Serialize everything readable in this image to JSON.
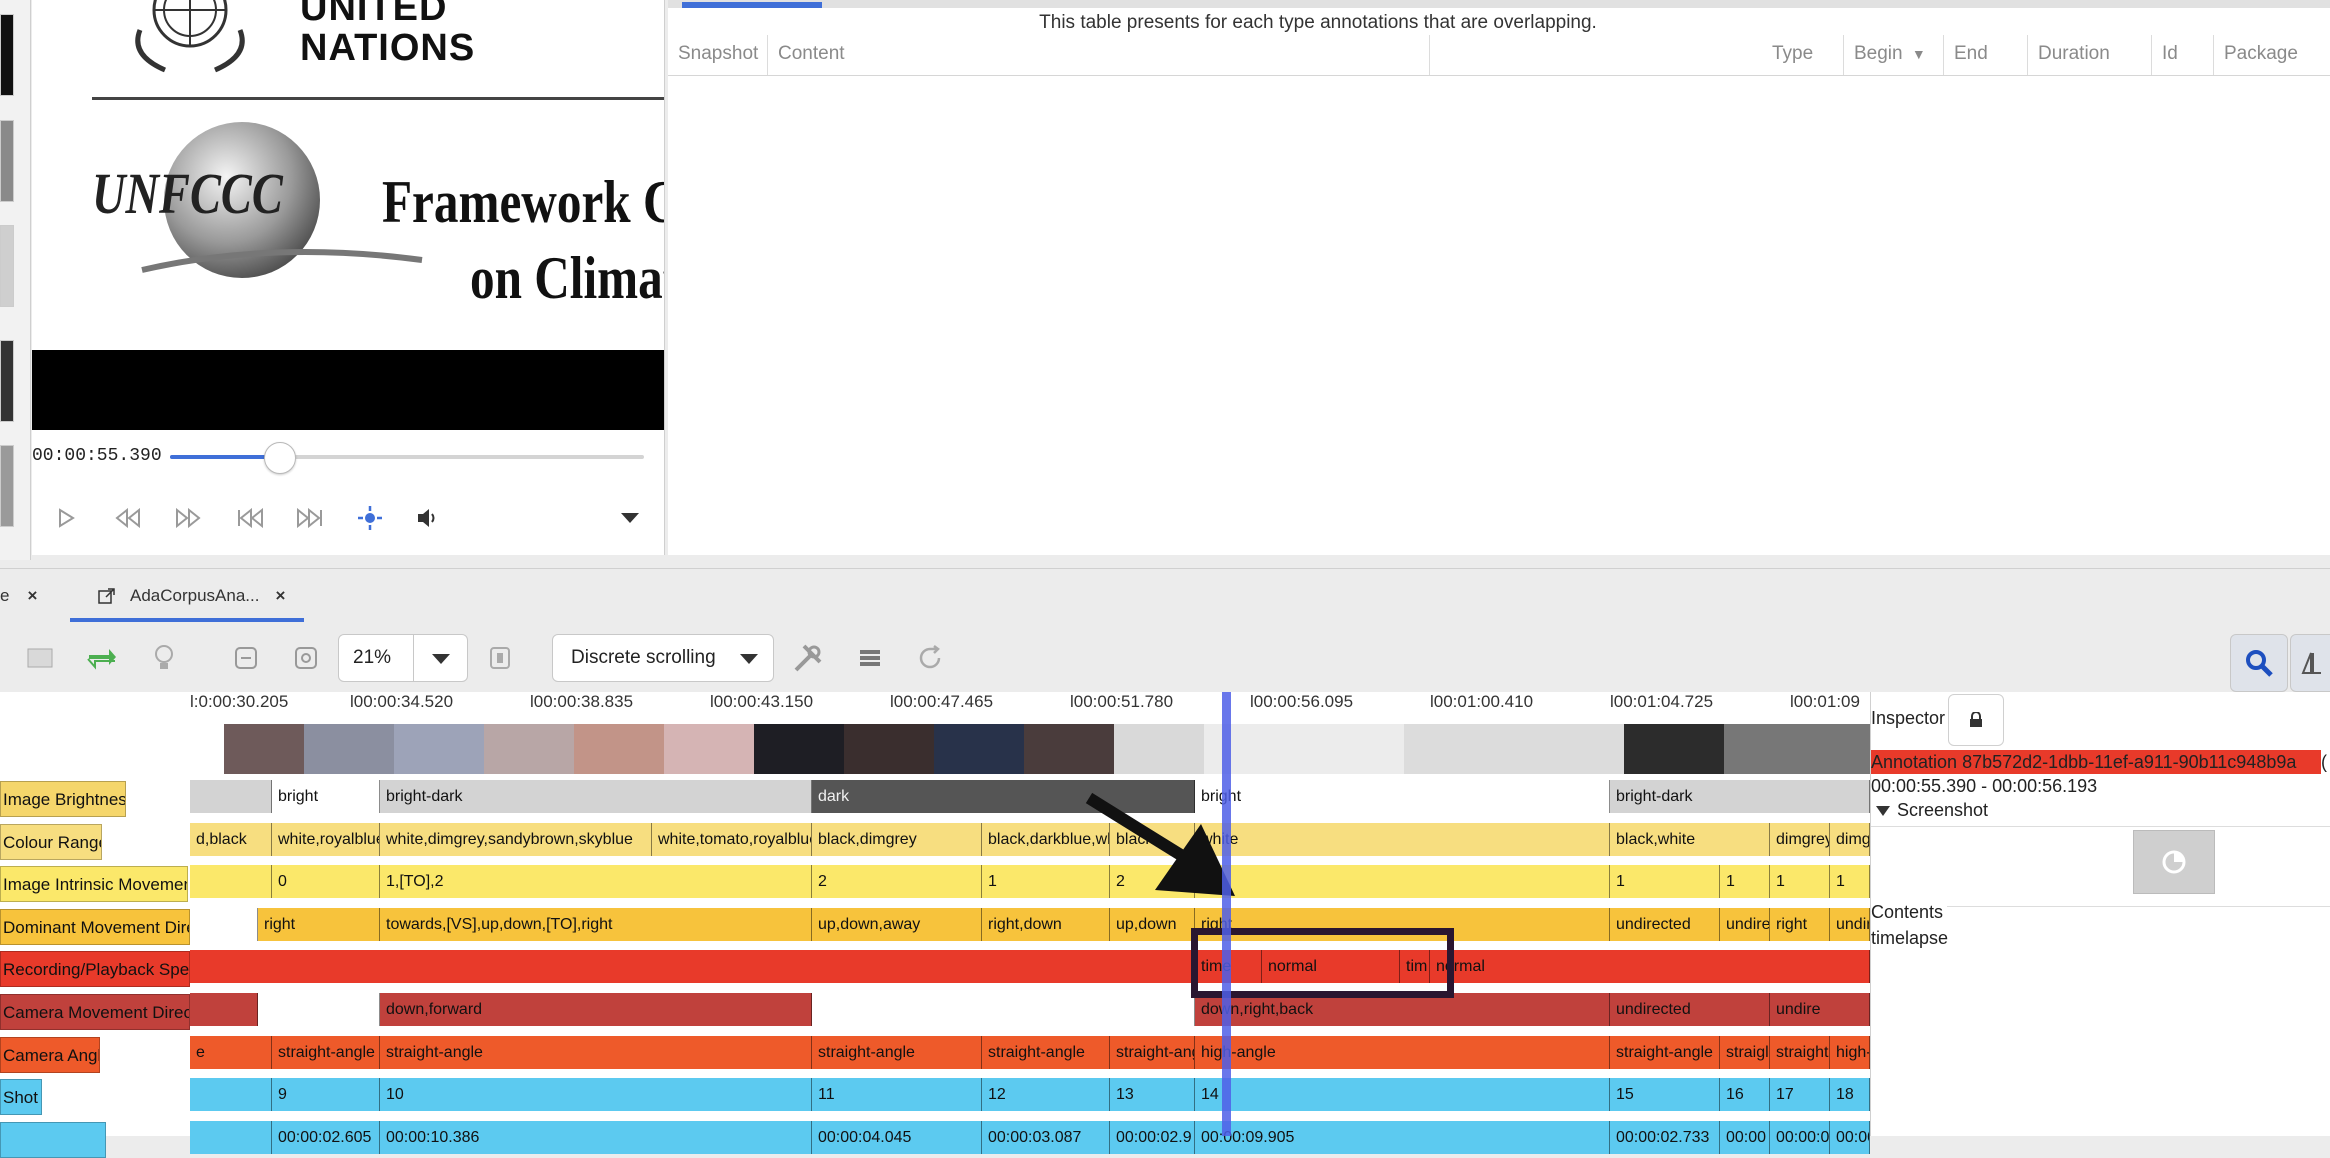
{
  "player": {
    "video_text": {
      "un_line1": "UNITED",
      "un_line2": "NATIONS",
      "unfccc": "UNFCCC",
      "framework_line1": "Framework Con",
      "framework_line2": "on Climate"
    },
    "timecode": "00:00:55.390",
    "progress_fraction": 0.23,
    "icons": [
      "play-icon",
      "step-back-icon",
      "step-forward-icon",
      "skip-start-icon",
      "skip-end-icon",
      "fullscreen-icon",
      "volume-icon",
      "chevron-down-icon"
    ]
  },
  "table_pane": {
    "caption": "This table presents for each type annotations that are overlapping.",
    "columns": [
      "Snapshot",
      "Content",
      "Type",
      "Begin",
      "End",
      "Duration",
      "Id",
      "Package"
    ],
    "sort_indicator": "▼"
  },
  "tabs": [
    {
      "label": "e",
      "close": "×"
    },
    {
      "label": "AdaCorpusAna...",
      "close": "×"
    }
  ],
  "toolbar": {
    "zoom_value": "21%",
    "scroll_mode": "Discrete scrolling"
  },
  "timeline": {
    "ticks": [
      "l:0:00:30.205",
      "l00:00:34.520",
      "l00:00:38.835",
      "l00:00:43.150",
      "l00:00:47.465",
      "l00:00:51.780",
      "l00:00:56.095",
      "l00:01:00.410",
      "l00:01:04.725",
      "l00:01:09"
    ],
    "tracks": [
      {
        "label": "Image Brightness",
        "label_color": "#f5d66b",
        "seg_color": "#ffffff",
        "segments": [
          {
            "text": "",
            "color": "#d3d3d3"
          },
          {
            "text": "bright"
          },
          {
            "text": "bright-dark",
            "color": "#d3d3d3"
          },
          {
            "text": "dark",
            "color": "#555555"
          },
          {
            "text": "bright"
          },
          {
            "text": "bright-dark",
            "color": "#d3d3d3"
          }
        ]
      },
      {
        "label": "Colour Range",
        "label_color": "#f7de80",
        "seg_color": "#f7de80",
        "segments": [
          {
            "text": "d,black"
          },
          {
            "text": "white,royalblue"
          },
          {
            "text": "white,dimgrey,sandybrown,skyblue"
          },
          {
            "text": "white,tomato,royalblue"
          },
          {
            "text": "black,dimgrey"
          },
          {
            "text": "black,darkblue,wh"
          },
          {
            "text": "black"
          },
          {
            "text": "white"
          },
          {
            "text": "black,white"
          },
          {
            "text": "dimgrey"
          },
          {
            "text": "dimg"
          }
        ]
      },
      {
        "label": "Image Intrinsic Movement",
        "label_color": "#fbe86a",
        "seg_color": "#fbe86a",
        "segments": [
          {
            "text": ""
          },
          {
            "text": "0"
          },
          {
            "text": "1,[TO],2"
          },
          {
            "text": "2"
          },
          {
            "text": "1"
          },
          {
            "text": "2"
          },
          {
            "text": "2"
          },
          {
            "text": "1"
          },
          {
            "text": "1"
          },
          {
            "text": "1"
          },
          {
            "text": "1"
          }
        ]
      },
      {
        "label": "Dominant Movement Direc",
        "label_color": "#f7c33c",
        "seg_color": "#f7c33c",
        "segments": [
          {
            "text": "",
            "color": "#ffffff"
          },
          {
            "text": "right"
          },
          {
            "text": "towards,[VS],up,down,[TO],right"
          },
          {
            "text": "up,down,away"
          },
          {
            "text": "right,down"
          },
          {
            "text": "up,down"
          },
          {
            "text": "right"
          },
          {
            "text": "undirected"
          },
          {
            "text": "undire"
          },
          {
            "text": "right"
          },
          {
            "text": "undir"
          }
        ]
      },
      {
        "label": "Recording/Playback Speed",
        "label_color": "#e83a2a",
        "seg_color": "#e83a2a",
        "segments": [
          {
            "text": ""
          },
          {
            "text": "time"
          },
          {
            "text": "normal"
          },
          {
            "text": "tim"
          },
          {
            "text": "normal"
          }
        ]
      },
      {
        "label": "Camera Movement Directio",
        "label_color": "#c0413c",
        "seg_color": "#c0413c",
        "segments": [
          {
            "text": ""
          },
          {
            "text": "",
            "color": "#ffffff"
          },
          {
            "text": "down,forward"
          },
          {
            "text": "",
            "color": "#ffffff"
          },
          {
            "text": "down,right,back"
          },
          {
            "text": "undirected"
          },
          {
            "text": "undire"
          },
          {
            "text": "",
            "color": "#ffffff"
          }
        ]
      },
      {
        "label": "Camera Angle",
        "label_color": "#ee5a2a",
        "seg_color": "#ee5a2a",
        "segments": [
          {
            "text": "e"
          },
          {
            "text": "straight-angle"
          },
          {
            "text": "straight-angle"
          },
          {
            "text": "straight-angle"
          },
          {
            "text": "straight-angle"
          },
          {
            "text": "straight-ang"
          },
          {
            "text": "high-angle"
          },
          {
            "text": "straight-angle"
          },
          {
            "text": "straigl"
          },
          {
            "text": "straight-"
          },
          {
            "text": "high-"
          }
        ]
      },
      {
        "label": "Shot",
        "label_color": "#5ccaf0",
        "seg_color": "#5ccaf0",
        "segments": [
          {
            "text": ""
          },
          {
            "text": "9"
          },
          {
            "text": "10"
          },
          {
            "text": "11"
          },
          {
            "text": "12"
          },
          {
            "text": "13"
          },
          {
            "text": "14"
          },
          {
            "text": "15"
          },
          {
            "text": "16"
          },
          {
            "text": "17"
          },
          {
            "text": "18"
          }
        ]
      },
      {
        "label": "",
        "label_color": "#5ccaf0",
        "seg_color": "#5ccaf0",
        "segments": [
          {
            "text": ""
          },
          {
            "text": "00:00:02.605"
          },
          {
            "text": "00:00:10.386"
          },
          {
            "text": "00:00:04.045"
          },
          {
            "text": "00:00:03.087"
          },
          {
            "text": "00:00:02.9"
          },
          {
            "text": "00:00:09.905"
          },
          {
            "text": "00:00:02.733"
          },
          {
            "text": "00:00"
          },
          {
            "text": "00:00:0"
          },
          {
            "text": "00:00"
          }
        ]
      }
    ]
  },
  "inspector": {
    "title": "Inspector",
    "annotation_id": "Annotation 87b572d2-1dbb-11ef-a911-90b11c948b9a",
    "annotation_paren": "(",
    "time_range": "00:00:55.390 - 00:00:56.193",
    "screenshot_label": "Screenshot",
    "contents_label": "Contents",
    "contents_value": "timelapse"
  },
  "colors": {
    "accent": "#3f6fd8",
    "playhead": "#4f5fe8",
    "annotation_highlight": "#e83a2a"
  }
}
